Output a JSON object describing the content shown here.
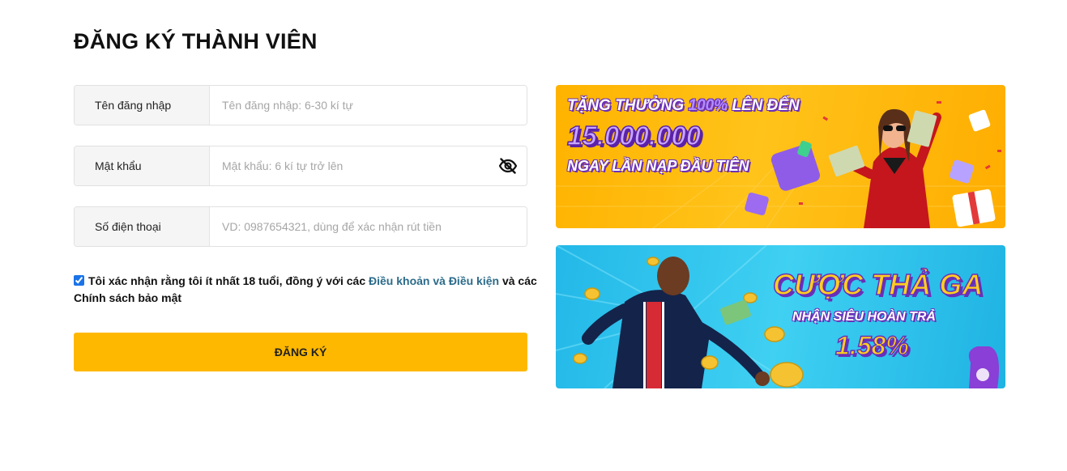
{
  "page": {
    "title": "ĐĂNG KÝ THÀNH VIÊN"
  },
  "form": {
    "username": {
      "label": "Tên đăng nhập",
      "placeholder": "Tên đăng nhập: 6-30 kí tự",
      "value": ""
    },
    "password": {
      "label": "Mật khẩu",
      "placeholder": "Mật khẩu: 6 kí tự trở lên",
      "value": "",
      "toggle_icon": "eye-off-icon"
    },
    "phone": {
      "label": "Số điện thoại",
      "placeholder": "VD: 0987654321, dùng để xác nhận rút tiền",
      "value": ""
    },
    "agreement": {
      "checked": true,
      "text_before": "Tôi xác nhận rằng tôi ít nhất 18 tuổi, đồng ý với các ",
      "terms_link": "Điều khoản và Điều kiện",
      "text_after": " và các Chính sách bảo mật"
    },
    "submit_label": "ĐĂNG KÝ"
  },
  "banners": [
    {
      "line1a": "TẶNG THƯỞNG ",
      "line1b": "100%",
      "line1c": " LÊN ĐẾN",
      "amount": "15.000.000",
      "line3": "NGAY LẦN NẠP ĐẦU TIÊN"
    },
    {
      "headline": "CƯỢC THẢ GA",
      "subline": "NHẬN SIÊU HOÀN TRẢ",
      "rate": "1.58%"
    }
  ],
  "colors": {
    "accent": "#ffb800",
    "link": "#2c6b8a",
    "banner1_bg": "#ffb300",
    "banner2_bg": "#2fc3ee",
    "banner_purple": "#6a2fb8"
  }
}
